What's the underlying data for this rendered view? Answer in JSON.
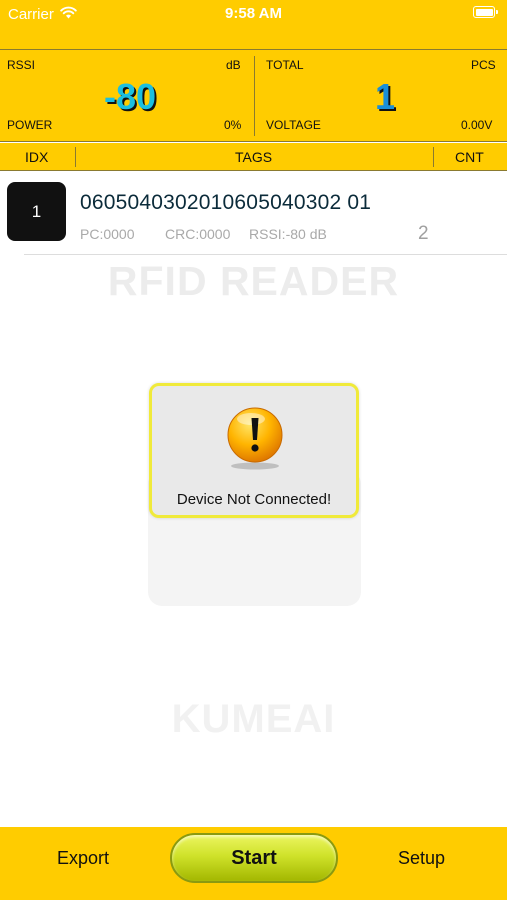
{
  "status_bar": {
    "carrier": "Carrier",
    "time": "9:58 AM"
  },
  "stats": {
    "rssi_label": "RSSI",
    "rssi_unit": "dB",
    "rssi_value": "-80",
    "power_label": "POWER",
    "power_value": "0%",
    "total_label": "TOTAL",
    "total_unit": "PCS",
    "total_value": "1",
    "voltage_label": "VOLTAGE",
    "voltage_value": "0.00V"
  },
  "columns": {
    "idx": "IDX",
    "tags": "TAGS",
    "cnt": "CNT"
  },
  "tags": [
    {
      "idx": "1",
      "epc": "0605040302010605040302 01",
      "pc": "PC:0000",
      "crc": "CRC:0000",
      "rssi": "RSSI:-80 dB",
      "count": "2"
    }
  ],
  "watermark": {
    "title": "RFID READER",
    "brand": "KUMEAI"
  },
  "alert": {
    "message": "Device Not Connected!"
  },
  "bottom_bar": {
    "export_label": "Export",
    "start_label": "Start",
    "setup_label": "Setup"
  },
  "colors": {
    "accent": "#ffcc00",
    "rssi_value": "#1bbfe0",
    "total_value": "#1a8fd8",
    "start_button": "#cfe22a",
    "alert_border": "#f0ea3a"
  },
  "icons": {
    "alert": "warning-exclamation-icon",
    "wifi": "wifi-icon",
    "battery": "battery-icon"
  }
}
